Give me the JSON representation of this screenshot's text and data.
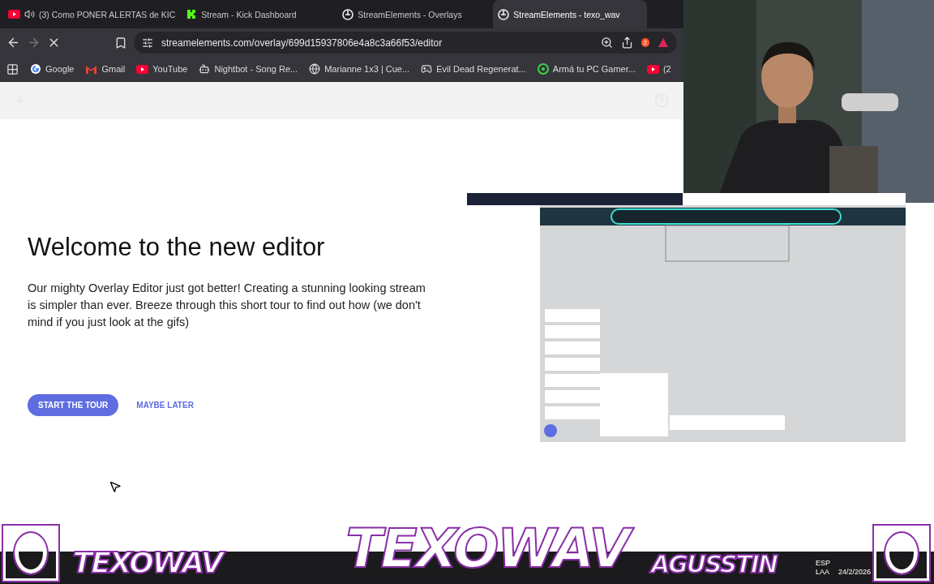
{
  "browser": {
    "tabs": [
      {
        "title": "(3) Como PONER ALERTAS de KIC",
        "audio": true,
        "selected": false
      },
      {
        "title": "Stream - Kick Dashboard",
        "audio": false,
        "selected": false
      },
      {
        "title": "StreamElements - Overlays",
        "audio": false,
        "selected": false
      },
      {
        "title": "StreamElements - texo_wav",
        "audio": false,
        "selected": true
      }
    ],
    "loading": true,
    "url": "streamelements.com/overlay/699d15937806e4a8c3a66f53/editor",
    "extension_badge": "2",
    "bookmarks": [
      {
        "label": "Google"
      },
      {
        "label": "Gmail"
      },
      {
        "label": "YouTube"
      },
      {
        "label": "Nightbot - Song Re..."
      },
      {
        "label": "Marianne 1x3 | Cue..."
      },
      {
        "label": "Evil Dead Regenerat..."
      },
      {
        "label": "Armá tu PC Gamer..."
      },
      {
        "label": "(2"
      }
    ]
  },
  "dialog": {
    "title": "Welcome to the new editor",
    "body": "Our mighty Overlay Editor just got better! Creating a stunning looking stream is simpler than ever. Breeze through this short tour to find out how (we don't mind if you just look at the gifs)",
    "primary": "START THE TOUR",
    "secondary": "MAYBE LATER"
  },
  "stream_overlay": {
    "left_logo": "TEXOWAV",
    "center_logo": "TEXOWAV",
    "right_logo": "AGUSSTIN",
    "taskbar": {
      "language": "ESP",
      "layout": "LAA",
      "date": "24/2/2026"
    }
  }
}
